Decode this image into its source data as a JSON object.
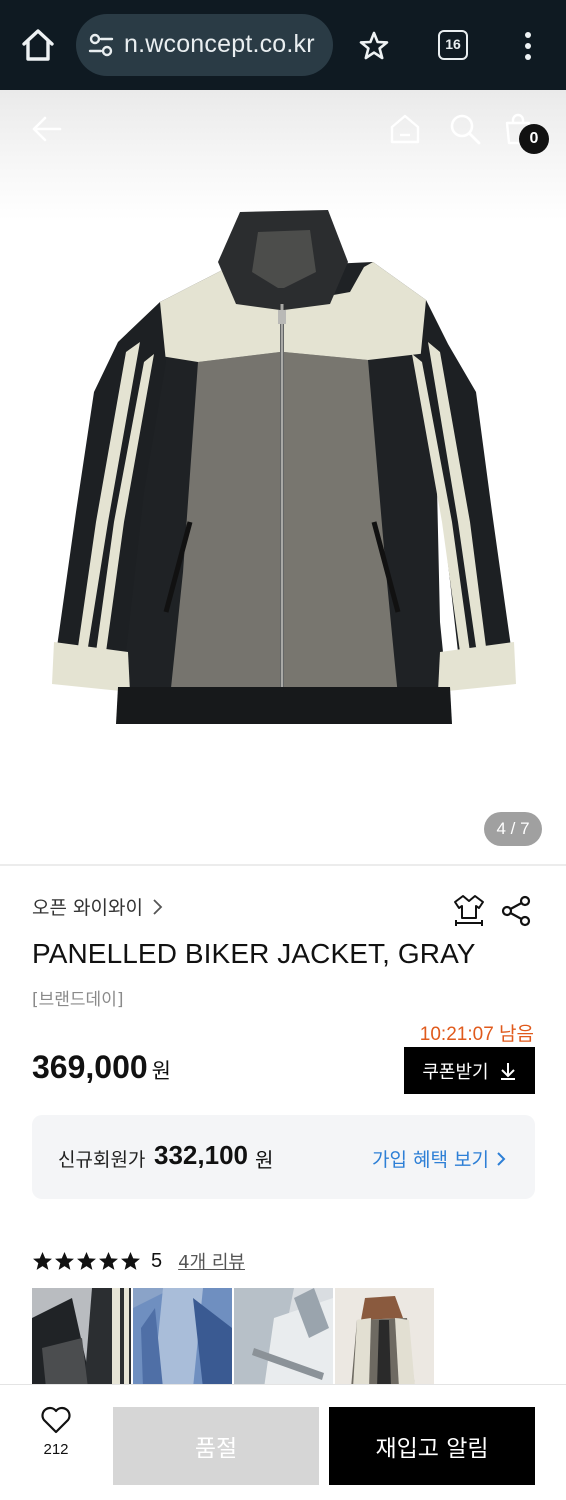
{
  "browser": {
    "url": "n.wconcept.co.kr",
    "tab_count": "16"
  },
  "header": {
    "cart_count": "0"
  },
  "gallery": {
    "counter": "4 / 7"
  },
  "product": {
    "brand": "오픈 와이와이",
    "title": "PANELLED BIKER JACKET, GRAY",
    "promo_label": "[브랜드데이]",
    "timer": "10:21:07 남음",
    "price": "369,000",
    "price_unit": "원",
    "coupon_label": "쿠폰받기"
  },
  "member": {
    "label": "신규회원가",
    "price": "332,100",
    "unit": "원",
    "benefit_link": "가입 혜택 보기"
  },
  "reviews": {
    "rating": "5",
    "stars_filled": 5,
    "review_link": "4개 리뷰"
  },
  "bottom": {
    "wish_count": "212",
    "soldout_label": "품절",
    "restock_label": "재입고 알림"
  },
  "colors": {
    "browser_bg": "#0f1a22",
    "timer_accent": "#e05a1c",
    "link_blue": "#2d7fd6",
    "button_black": "#000000",
    "soldout_gray": "#d6d6d6"
  }
}
